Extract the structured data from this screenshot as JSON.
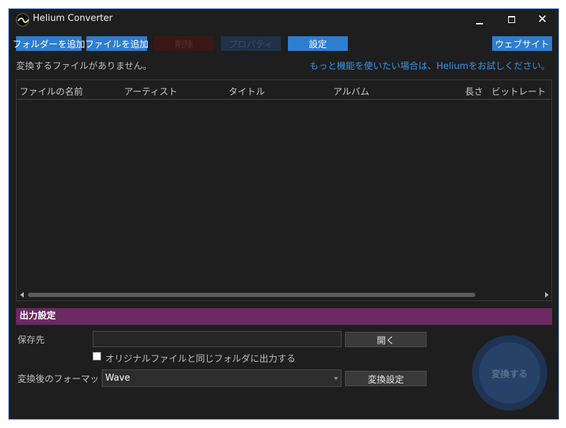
{
  "window": {
    "title": "Helium Converter"
  },
  "titlebar": {
    "close_glyph": "✕"
  },
  "toolbar": {
    "add_folder": "フォルダーを追加",
    "add_file": "ファイルを追加",
    "delete": "削除",
    "properties": "プロパティ",
    "settings": "設定",
    "website": "ウェブサイト"
  },
  "info": {
    "status": "変換するファイルがありません。",
    "promo_link": "もっと機能を使いたい場合は、Heliumをお試しください。"
  },
  "file_list": {
    "columns": [
      "ファイルの名前",
      "アーティスト",
      "タイトル",
      "アルバム",
      "長さ",
      "ビットレート"
    ],
    "rows": []
  },
  "output_settings": {
    "header": "出力設定",
    "save_to_label": "保存先",
    "save_to_value": "",
    "open_button": "開く",
    "same_folder_checkbox": "オリジナルファイルと同じフォルダに出力する",
    "same_folder_checked": false,
    "format_label": "変換後のフォーマット:",
    "format_value": "Wave",
    "convert_settings_button": "変換設定",
    "convert_button": "変換する"
  },
  "icons": {
    "app_logo": "helium-wave-logo-icon",
    "minimize": "minimize-icon",
    "maximize": "maximize-icon",
    "close": "close-icon"
  },
  "colors": {
    "accent_blue": "#2f7dd1",
    "link_blue": "#3a93e6",
    "section_purple": "#6b2a61",
    "background": "#1e1e1e"
  }
}
